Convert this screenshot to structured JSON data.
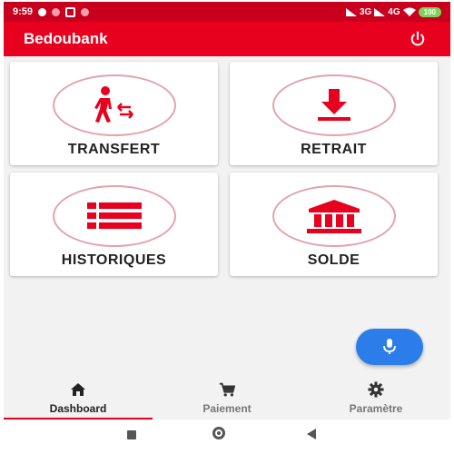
{
  "status_bar": {
    "time": "9:59",
    "network_1": "3G",
    "network_2": "4G",
    "battery": "100"
  },
  "app_bar": {
    "title": "Bedoubank",
    "power_icon": "power-icon"
  },
  "cards": {
    "transfert": {
      "label": "TRANSFERT",
      "icon": "transfer-person-icon"
    },
    "retrait": {
      "label": "RETRAIT",
      "icon": "download-icon"
    },
    "historiques": {
      "label": "HISTORIQUES",
      "icon": "list-icon"
    },
    "solde": {
      "label": "SOLDE",
      "icon": "bank-icon"
    }
  },
  "fab": {
    "icon": "microphone-icon"
  },
  "bottom_nav": {
    "items": [
      {
        "label": "Dashboard",
        "icon": "home-icon",
        "active": true
      },
      {
        "label": "Paiement",
        "icon": "cart-icon",
        "active": false
      },
      {
        "label": "Paramètre",
        "icon": "gear-icon",
        "active": false
      }
    ]
  },
  "colors": {
    "primary": "#e8001f",
    "status_bar": "#c8001e",
    "fab": "#2b7de9",
    "card_icon": "#e8001f"
  }
}
